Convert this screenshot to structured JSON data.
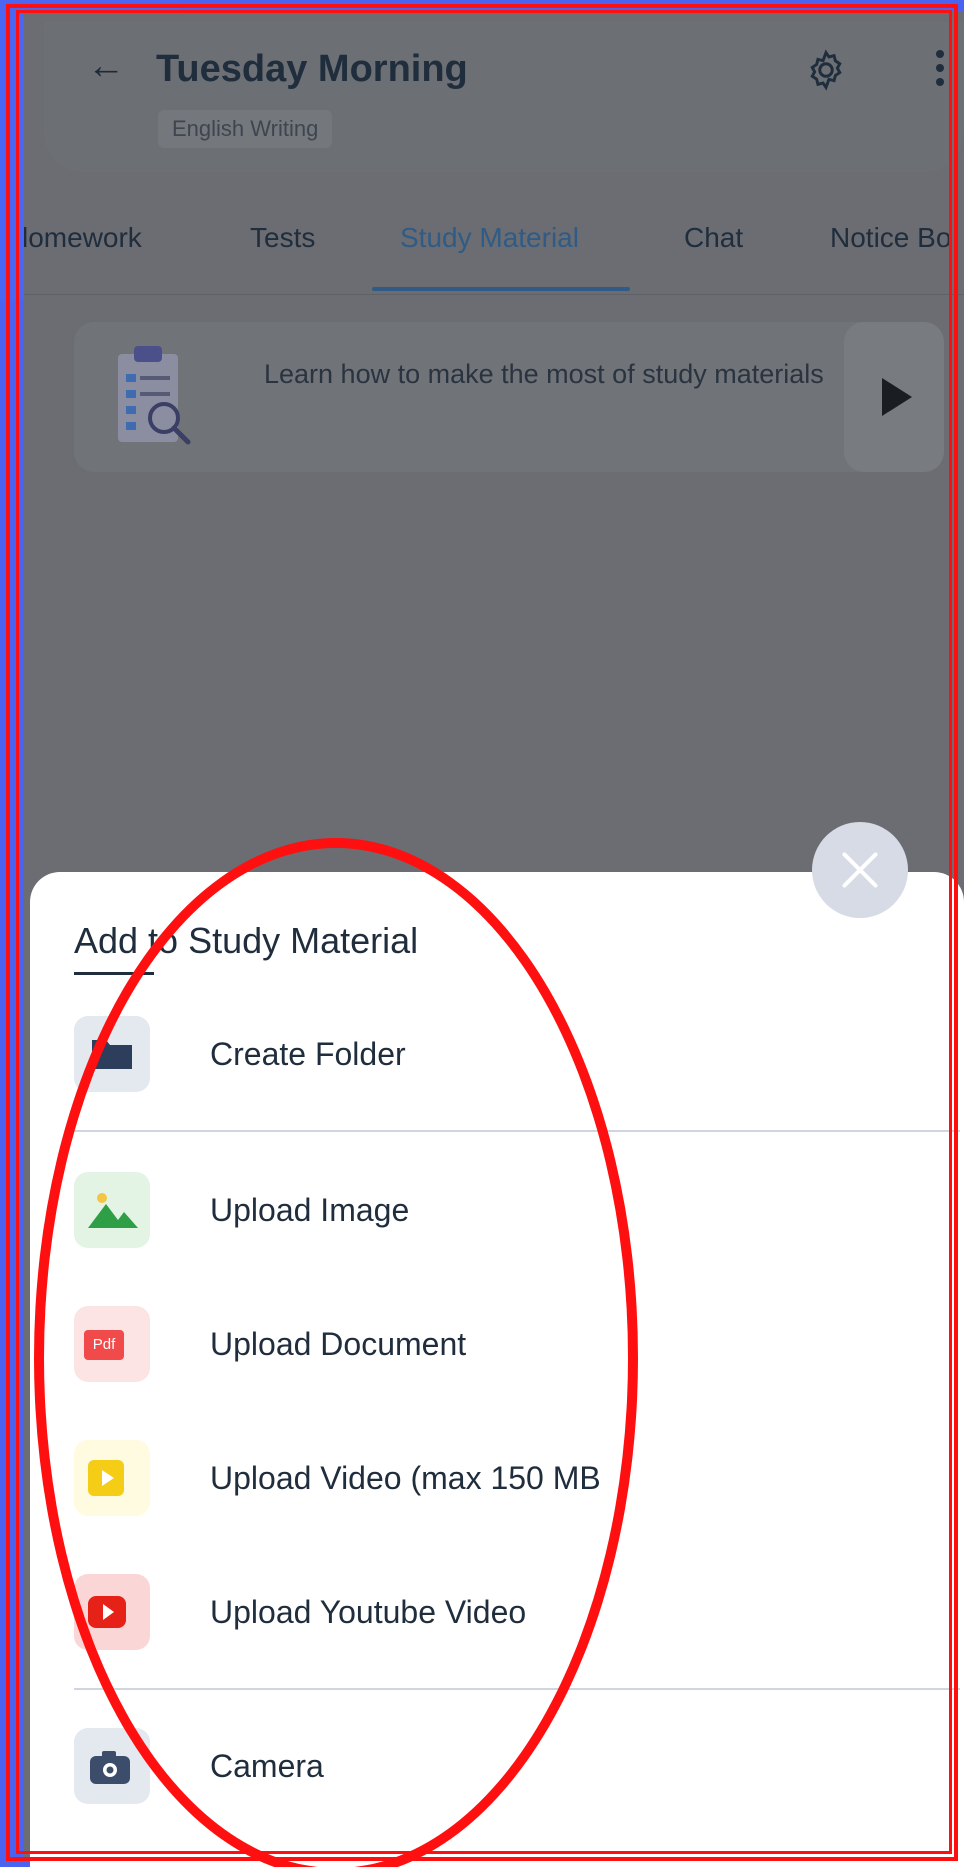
{
  "header": {
    "title": "Tuesday Morning",
    "subtitle": "English Writing"
  },
  "tabs": [
    {
      "label": "Homework",
      "display": "lomework",
      "active": false
    },
    {
      "label": "Tests",
      "active": false
    },
    {
      "label": "Study Material",
      "active": true
    },
    {
      "label": "Chat",
      "active": false
    },
    {
      "label": "Notice Board",
      "display": "Notice Bo",
      "active": false
    }
  ],
  "promo": {
    "text": "Learn how to make the most of study materials"
  },
  "sheet": {
    "title": "Add to Study Material",
    "items": [
      {
        "label": "Create Folder",
        "icon": "folder-icon"
      },
      {
        "label": "Upload Image",
        "icon": "image-icon"
      },
      {
        "label": "Upload Document",
        "icon": "pdf-icon",
        "icon_text": "Pdf"
      },
      {
        "label": "Upload Video (max 150 MB",
        "icon": "video-icon"
      },
      {
        "label": "Upload Youtube Video",
        "icon": "youtube-icon"
      },
      {
        "label": "Camera",
        "icon": "camera-icon"
      }
    ]
  },
  "colors": {
    "accent": "#2f5b86",
    "annotation": "#ff1010",
    "frame": "#4a63f0"
  }
}
